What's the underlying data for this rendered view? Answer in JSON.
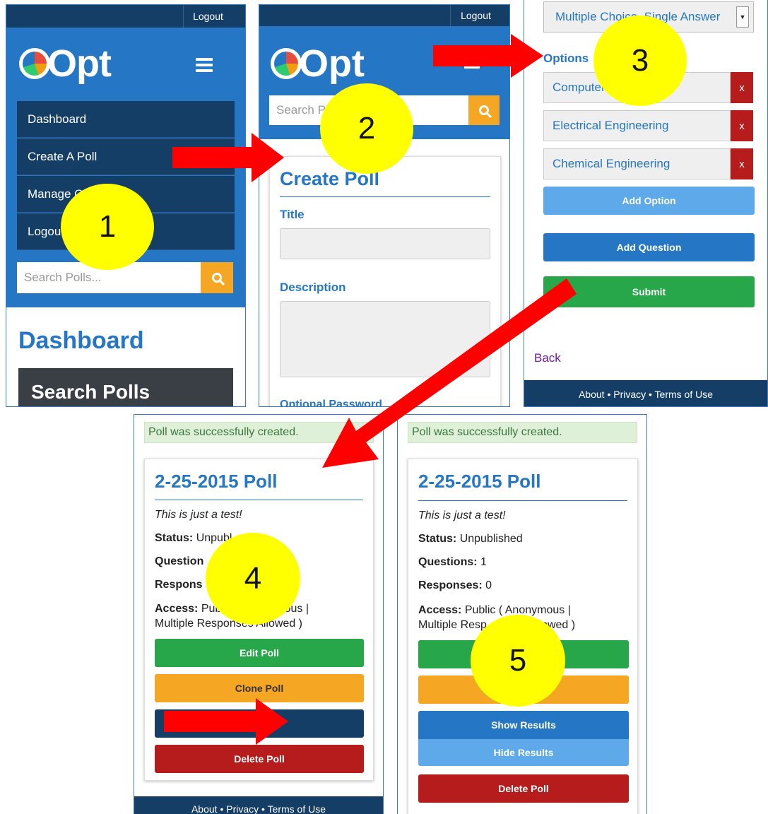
{
  "screen1": {
    "logout": "Logout",
    "logo": "Opt",
    "nav": [
      "Dashboard",
      "Create A Poll",
      "Manage Q",
      "Logou"
    ],
    "search_placeholder": "Search Polls...",
    "heading": "Dashboard",
    "subheading": "Search Polls"
  },
  "screen2": {
    "logout": "Logout",
    "logo": "Opt",
    "search_placeholder": "Search P",
    "title": "Create Poll",
    "title_label": "Title",
    "description_label": "Description",
    "password_label": "Optional Password"
  },
  "screen3": {
    "type_select": "Multiple Choice, Single Answer",
    "options_label": "Options",
    "options": [
      "Computer",
      "Electrical Engineering",
      "Chemical Engineering"
    ],
    "remove_label": "x",
    "add_option": "Add Option",
    "add_question": "Add Question",
    "submit": "Submit",
    "back": "Back",
    "footer": "About • Privacy • Terms of Use"
  },
  "screen4": {
    "alert": "Poll was successfully created.",
    "poll_title": "2-25-2015 Poll",
    "description": "This is just a test!",
    "status_label": "Status:",
    "status_value": "Unpubl",
    "questions_label": "Question",
    "responses_label": "Respons",
    "access_label": "Access:",
    "access_value_1": "Pub",
    "access_value_2": "ymous |",
    "access_value_3": "Multiple Responses Allowed )",
    "edit": "Edit Poll",
    "clone": "Clone Poll",
    "delete": "Delete Poll",
    "footer": "About • Privacy • Terms of Use"
  },
  "screen5": {
    "alert": "Poll was successfully created.",
    "poll_title": "2-25-2015 Poll",
    "description": "This is just a test!",
    "status_label": "Status:",
    "status_value": "Unpublished",
    "questions_label": "Questions:",
    "questions_value": "1",
    "responses_label": "Responses:",
    "responses_value": "0",
    "access_label": "Access:",
    "access_value_1": "Public ( Anonymous |",
    "access_value_2": "Multiple Resp",
    "access_value_3": "llowed )",
    "show_results": "Show Results",
    "hide_results": "Hide Results",
    "delete": "Delete Poll"
  },
  "step_markers": [
    "1",
    "2",
    "3",
    "4",
    "5"
  ],
  "colors": {
    "primary_blue": "#2577c6",
    "navy": "#153e66",
    "green": "#27a74a",
    "orange": "#f5a623",
    "red": "#b71c1c",
    "light_blue": "#5da9e9",
    "marker_yellow": "#ffff00",
    "arrow_red": "#ff0000"
  }
}
